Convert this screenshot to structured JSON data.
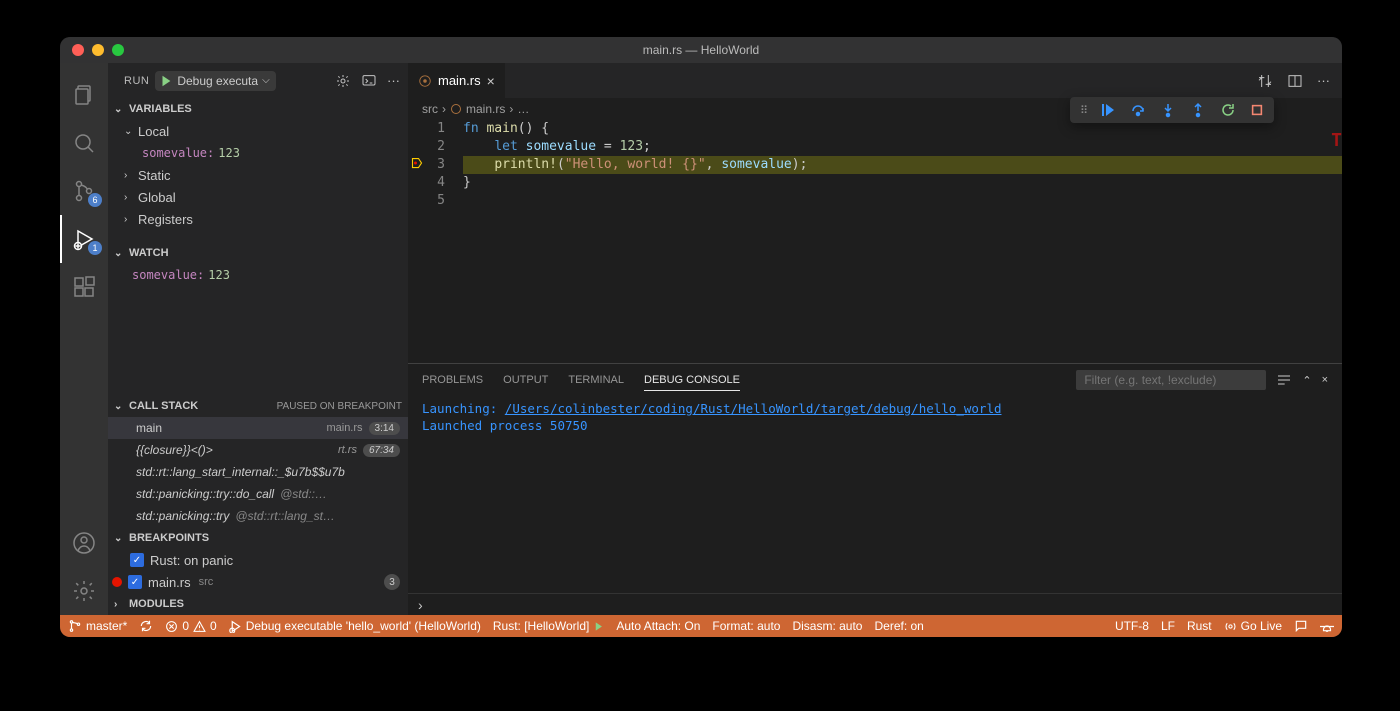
{
  "window": {
    "title": "main.rs — HelloWorld"
  },
  "sidebar": {
    "run_label": "RUN",
    "config_selected": "Debug executa",
    "sections": {
      "variables_title": "VARIABLES",
      "local_label": "Local",
      "local_var": {
        "name": "somevalue",
        "value": "123"
      },
      "static_label": "Static",
      "global_label": "Global",
      "registers_label": "Registers",
      "watch_title": "WATCH",
      "watch_var": {
        "name": "somevalue",
        "value": "123"
      },
      "callstack_title": "CALL STACK",
      "callstack_status": "PAUSED ON BREAKPOINT",
      "callstack": [
        {
          "fn": "main",
          "file": "main.rs",
          "pos": "3:14",
          "sel": true
        },
        {
          "fn": "{{closure}}<()>",
          "file": "rt.rs",
          "pos": "67:34"
        },
        {
          "fn": "std::rt::lang_start_internal::_$u7b$$u7b",
          "dim": ""
        },
        {
          "fn": "std::panicking::try::do_call",
          "dim": "@std::…"
        },
        {
          "fn": "std::panicking::try",
          "dim": "@std::rt::lang_st…"
        }
      ],
      "breakpoints_title": "BREAKPOINTS",
      "bp1_label": "Rust: on panic",
      "bp2_label": "main.rs",
      "bp2_src": "src",
      "bp2_line": "3",
      "modules_title": "MODULES"
    }
  },
  "activity": {
    "scm_badge": "6",
    "debug_badge": "1"
  },
  "editor": {
    "tab_label": "main.rs",
    "breadcrumb": {
      "folder": "src",
      "file": "main.rs",
      "more": "…"
    },
    "lines": [
      "1",
      "2",
      "3",
      "4",
      "5"
    ],
    "code": {
      "l1_kw": "fn",
      "l1_fn": " main",
      "l1_rest": "() {",
      "l2_kw": "let",
      "l2_ident": " somevalue",
      "l2_rest": " = ",
      "l2_num": "123",
      "l2_semi": ";",
      "l3_mac": "println!",
      "l3_open": "(",
      "l3_str": "\"Hello, world! {}\"",
      "l3_comma": ", ",
      "l3_arg": "somevalue",
      "l3_close": ");",
      "l4": "}"
    }
  },
  "panel": {
    "tabs": {
      "problems": "PROBLEMS",
      "output": "OUTPUT",
      "terminal": "TERMINAL",
      "debug": "DEBUG CONSOLE"
    },
    "filter_placeholder": "Filter (e.g. text, !exclude)",
    "line1_prefix": "Launching: ",
    "line1_link": "/Users/colinbester/coding/Rust/HelloWorld/target/debug/hello_world",
    "line2": "Launched process 50750"
  },
  "statusbar": {
    "branch": "master*",
    "errors": "0",
    "warnings": "0",
    "debug_target": "Debug executable 'hello_world' (HelloWorld)",
    "rust": "Rust: [HelloWorld]",
    "auto_attach": "Auto Attach: On",
    "format": "Format: auto",
    "disasm": "Disasm: auto",
    "deref": "Deref: on",
    "encoding": "UTF-8",
    "eol": "LF",
    "lang": "Rust",
    "golive": "Go Live"
  }
}
